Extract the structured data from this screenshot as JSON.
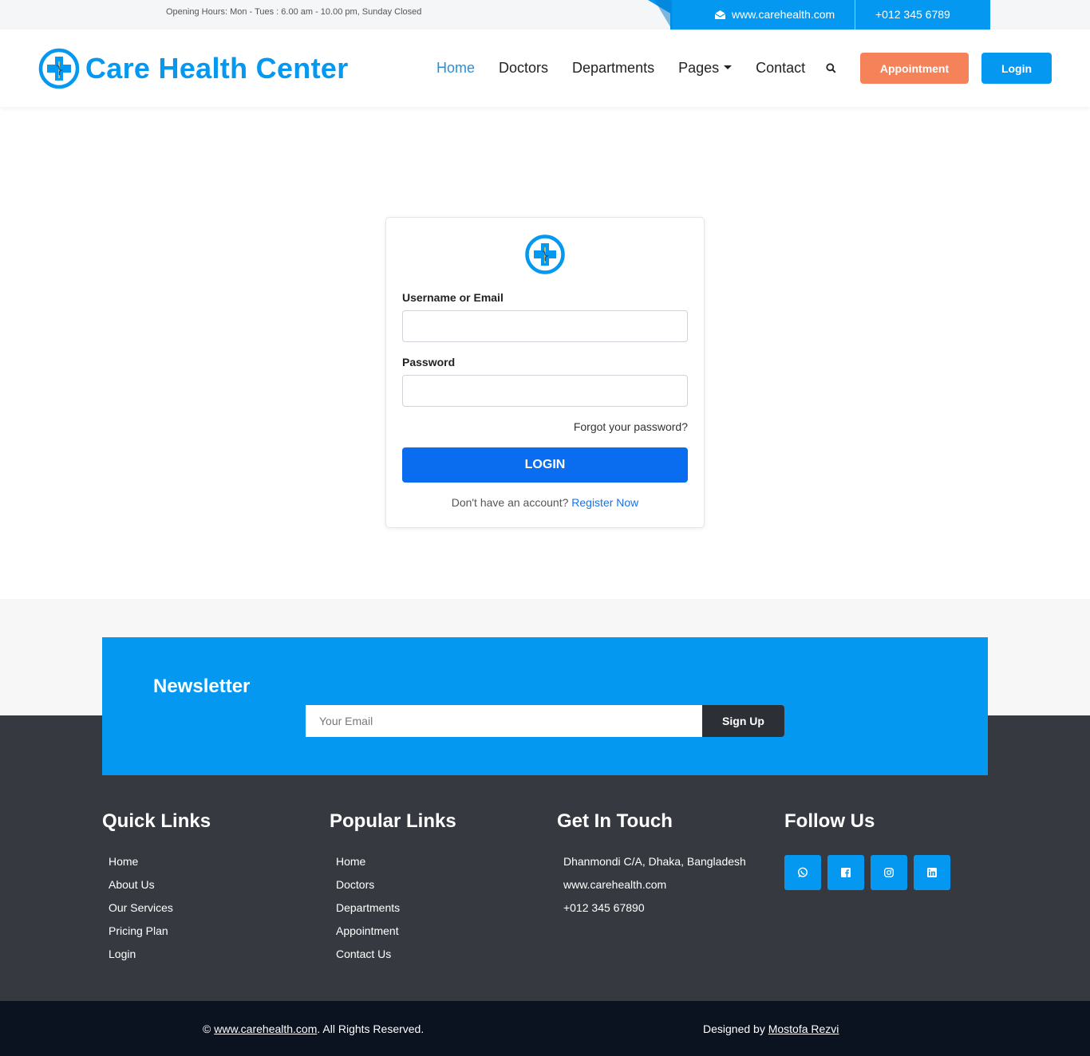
{
  "topbar": {
    "hours": "Opening Hours: Mon - Tues : 6.00 am - 10.00 pm, Sunday Closed",
    "website": "www.carehealth.com",
    "phone": "+012 345 6789"
  },
  "header": {
    "brand": "Care Health Center",
    "nav": [
      "Home",
      "Doctors",
      "Departments",
      "Pages",
      "Contact"
    ],
    "appointment_label": "Appointment",
    "login_label": "Login"
  },
  "login": {
    "username_label": "Username or Email",
    "password_label": "Password",
    "forgot": "Forgot your password?",
    "submit": "LOGIN",
    "no_account": "Don't have an account?",
    "register": "Register Now"
  },
  "newsletter": {
    "title": "Newsletter",
    "placeholder": "Your Email",
    "signup": "Sign Up"
  },
  "footer": {
    "quick_links": {
      "title": "Quick Links",
      "items": [
        "Home",
        "About Us",
        "Our Services",
        "Pricing Plan",
        "Login"
      ]
    },
    "popular_links": {
      "title": "Popular Links",
      "items": [
        "Home",
        "Doctors",
        "Departments",
        "Appointment",
        "Contact Us"
      ]
    },
    "get_in_touch": {
      "title": "Get In Touch",
      "items": [
        "Dhanmondi C/A, Dhaka, Bangladesh",
        "www.carehealth.com",
        "+012 345 67890"
      ]
    },
    "follow_us": {
      "title": "Follow Us",
      "icons": [
        "whatsapp-icon",
        "facebook-icon",
        "instagram-icon",
        "linkedin-icon"
      ]
    }
  },
  "bottom": {
    "copyright_symbol": "©",
    "copyright_link": "www.carehealth.com",
    "copyright_rest": ". All Rights Reserved.",
    "designed_by": "Designed by",
    "designer": "Mostofa Rezvi"
  },
  "colors": {
    "primary": "#0498f0",
    "accent": "#f6825a",
    "login_button": "#0a6df0",
    "footer": "#363a40"
  }
}
